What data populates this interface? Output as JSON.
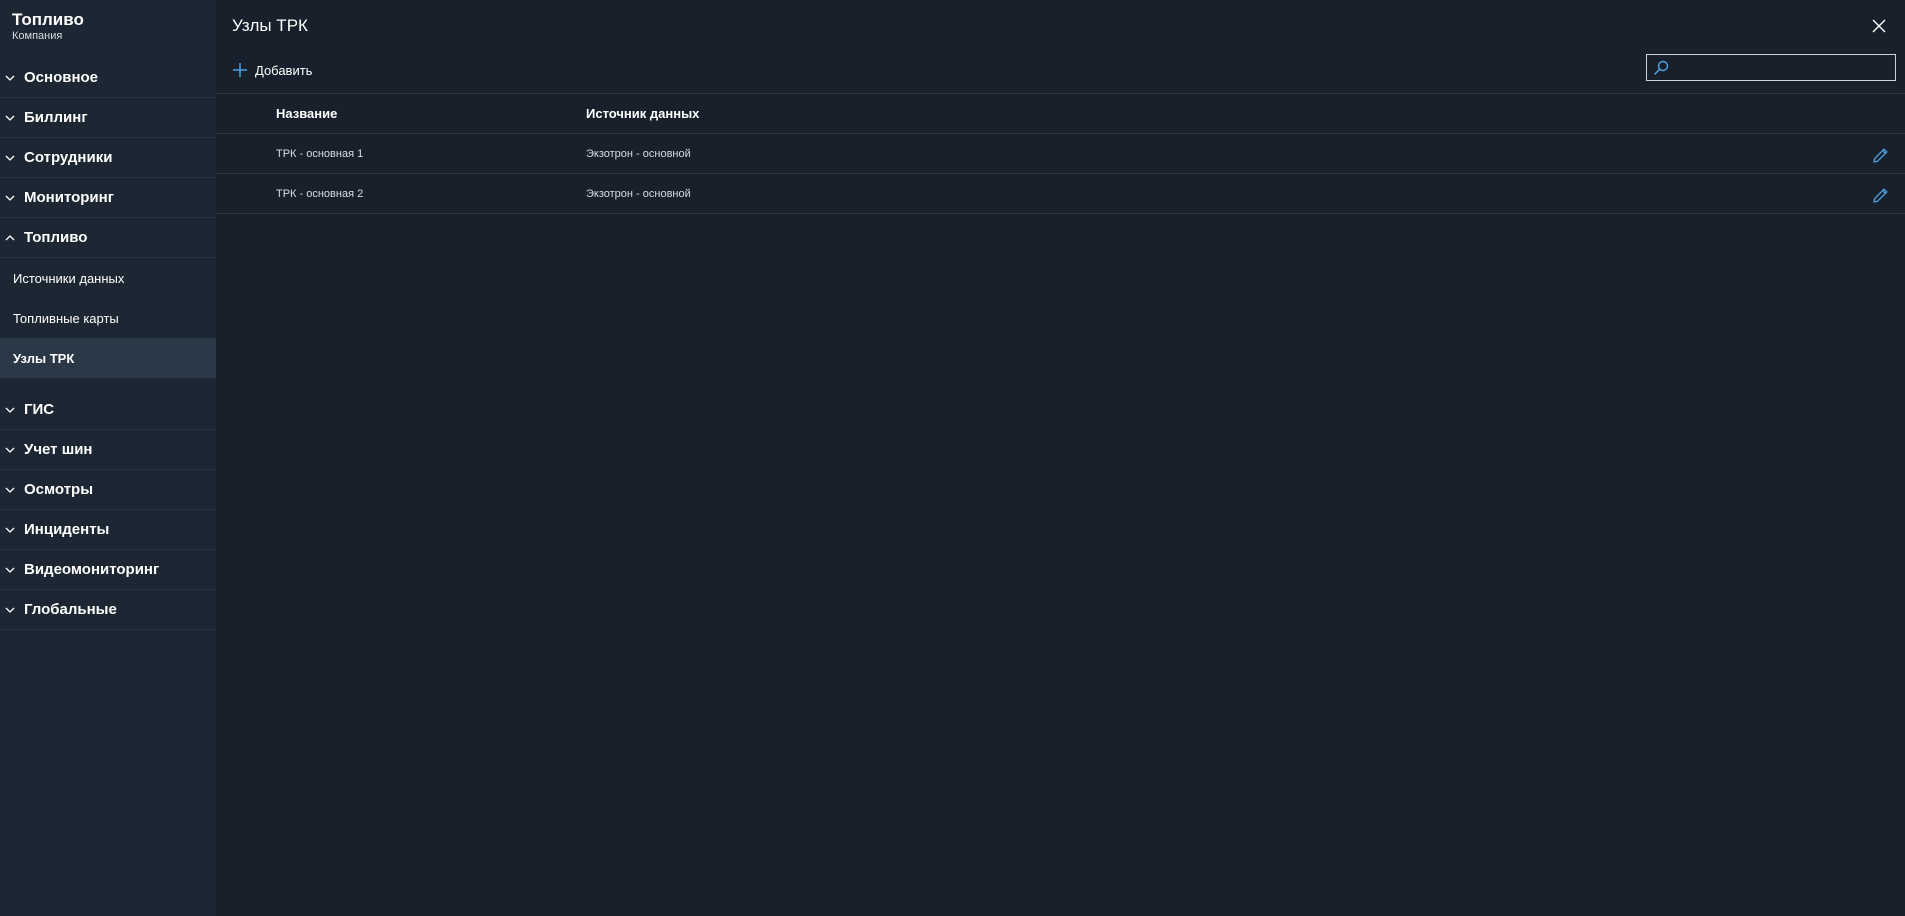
{
  "sidebar": {
    "title": "Топливо",
    "subtitle": "Компания",
    "groups_before": [
      {
        "label": "Основное",
        "expanded": false
      },
      {
        "label": "Биллинг",
        "expanded": false
      },
      {
        "label": "Сотрудники",
        "expanded": false
      },
      {
        "label": "Мониторинг",
        "expanded": false
      }
    ],
    "active_group": {
      "label": "Топливо",
      "expanded": true,
      "items": [
        {
          "label": "Источники данных",
          "active": false
        },
        {
          "label": "Топливные карты",
          "active": false
        },
        {
          "label": "Узлы ТРК",
          "active": true
        }
      ]
    },
    "groups_after": [
      {
        "label": "ГИС",
        "expanded": false
      },
      {
        "label": "Учет шин",
        "expanded": false
      },
      {
        "label": "Осмотры",
        "expanded": false
      },
      {
        "label": "Инциденты",
        "expanded": false
      },
      {
        "label": "Видеомониторинг",
        "expanded": false
      },
      {
        "label": "Глобальные",
        "expanded": false
      }
    ]
  },
  "main": {
    "title": "Узлы ТРК",
    "toolbar": {
      "add_label": "Добавить",
      "search_value": "",
      "search_placeholder": ""
    },
    "table": {
      "columns": [
        "Название",
        "Источник данных"
      ],
      "rows": [
        {
          "name": "ТРК - основная 1",
          "source": "Экзотрон - основной"
        },
        {
          "name": "ТРК - основная 2",
          "source": "Экзотрон - основной"
        }
      ]
    }
  },
  "icons": {
    "close": "close-icon",
    "add": "plus-icon",
    "search": "search-icon",
    "edit": "pencil-icon",
    "chevron_down": "chevron-down-icon",
    "chevron_up": "chevron-up-icon"
  },
  "colors": {
    "background": "#17202b",
    "sidebar": "#1d2733",
    "active_item": "#2b3848",
    "accent": "#4ea3e6",
    "divider": "#2b3643"
  }
}
